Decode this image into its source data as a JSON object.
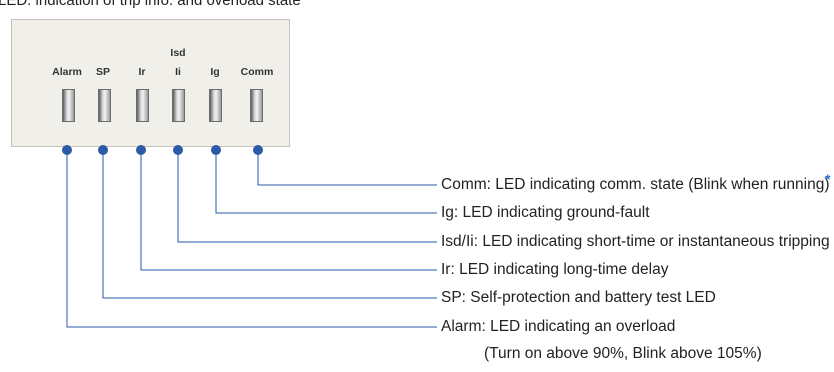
{
  "caption": "LED: indication of trip info. and overload state",
  "panel_labels": {
    "alarm": "Alarm",
    "sp": "SP",
    "ir": "Ir",
    "isd": "Isd",
    "ii": "Ii",
    "ig": "Ig",
    "comm": "Comm"
  },
  "descriptions": {
    "comm": "Comm: LED indicating comm. state (Blink when running)",
    "ig": "Ig: LED indicating ground-fault",
    "isd_ii": "Isd/Ii: LED indicating short-time or instantaneous tripping",
    "ir": "Ir: LED indicating long-time delay",
    "sp": "SP: Self-protection and battery test LED",
    "alarm": "Alarm: LED indicating an overload",
    "alarm_note": "(Turn on above 90%, Blink above 105%)"
  },
  "footnote_marker": "*",
  "colors": {
    "connector": "#2a5aa8",
    "panel_bg": "#f1efe9",
    "asterisk": "#2a6fcf"
  }
}
